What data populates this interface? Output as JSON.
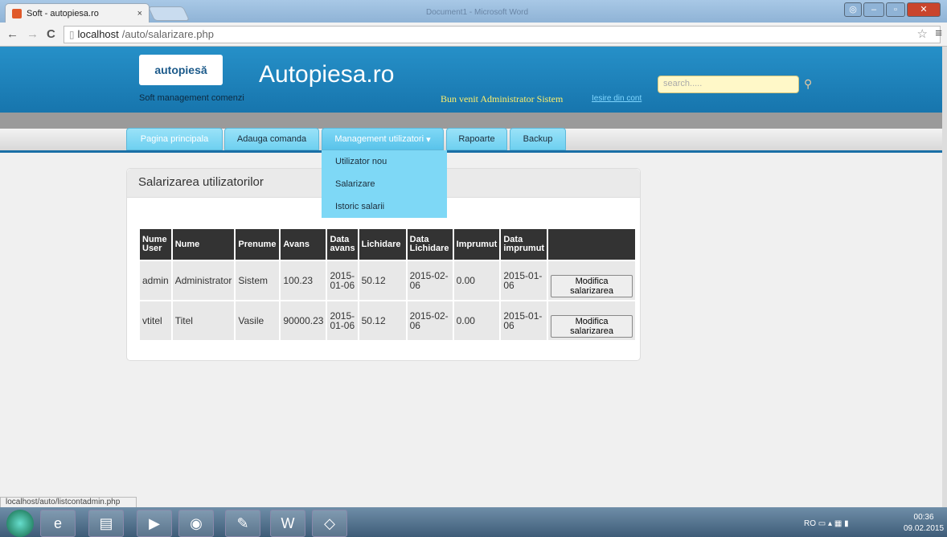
{
  "browser": {
    "tab_title": "Soft - autopiesa.ro",
    "tab_close": "×",
    "bg_window_title": "Document1 - Microsoft Word",
    "back": "←",
    "forward": "→",
    "reload": "C",
    "url_host": "localhost",
    "url_path": "/auto/salarizare.php",
    "star": "☆",
    "menu": "≡"
  },
  "header": {
    "logo_text": "autopiesă",
    "subtitle": "Soft management comenzi",
    "site_title": "Autopiesa.ro",
    "welcome": "Bun venit Administrator Sistem",
    "logout": "Iesire din cont",
    "search_placeholder": "search....."
  },
  "nav": {
    "items": [
      "Pagina principala",
      "Adauga comanda",
      "Management utilizatori",
      "Rapoarte",
      "Backup"
    ],
    "caret": "▾",
    "dropdown": [
      "Utilizator nou",
      "Salarizare",
      "Istoric salarii"
    ]
  },
  "panel": {
    "title": "Salarizarea utilizatorilor"
  },
  "table": {
    "headers": [
      "Nume User",
      "Nume",
      "Prenume",
      "Avans",
      "Data avans",
      "Lichidare",
      "Data Lichidare",
      "Imprumut",
      "Data imprumut",
      ""
    ],
    "rows": [
      [
        "admin",
        "Administrator",
        "Sistem",
        "100.23",
        "2015-01-06",
        "50.12",
        "2015-02-06",
        "0.00",
        "2015-01-06"
      ],
      [
        "vtitel",
        "Titel",
        "Vasile",
        "90000.23",
        "2015-01-06",
        "50.12",
        "2015-02-06",
        "0.00",
        "2015-01-06"
      ]
    ],
    "action_label": "Modifica salarizarea"
  },
  "status": {
    "url": "localhost/auto/listcontadmin.php"
  },
  "taskbar": {
    "lang": "RO",
    "time": "00:36",
    "date": "09.02.2015"
  }
}
